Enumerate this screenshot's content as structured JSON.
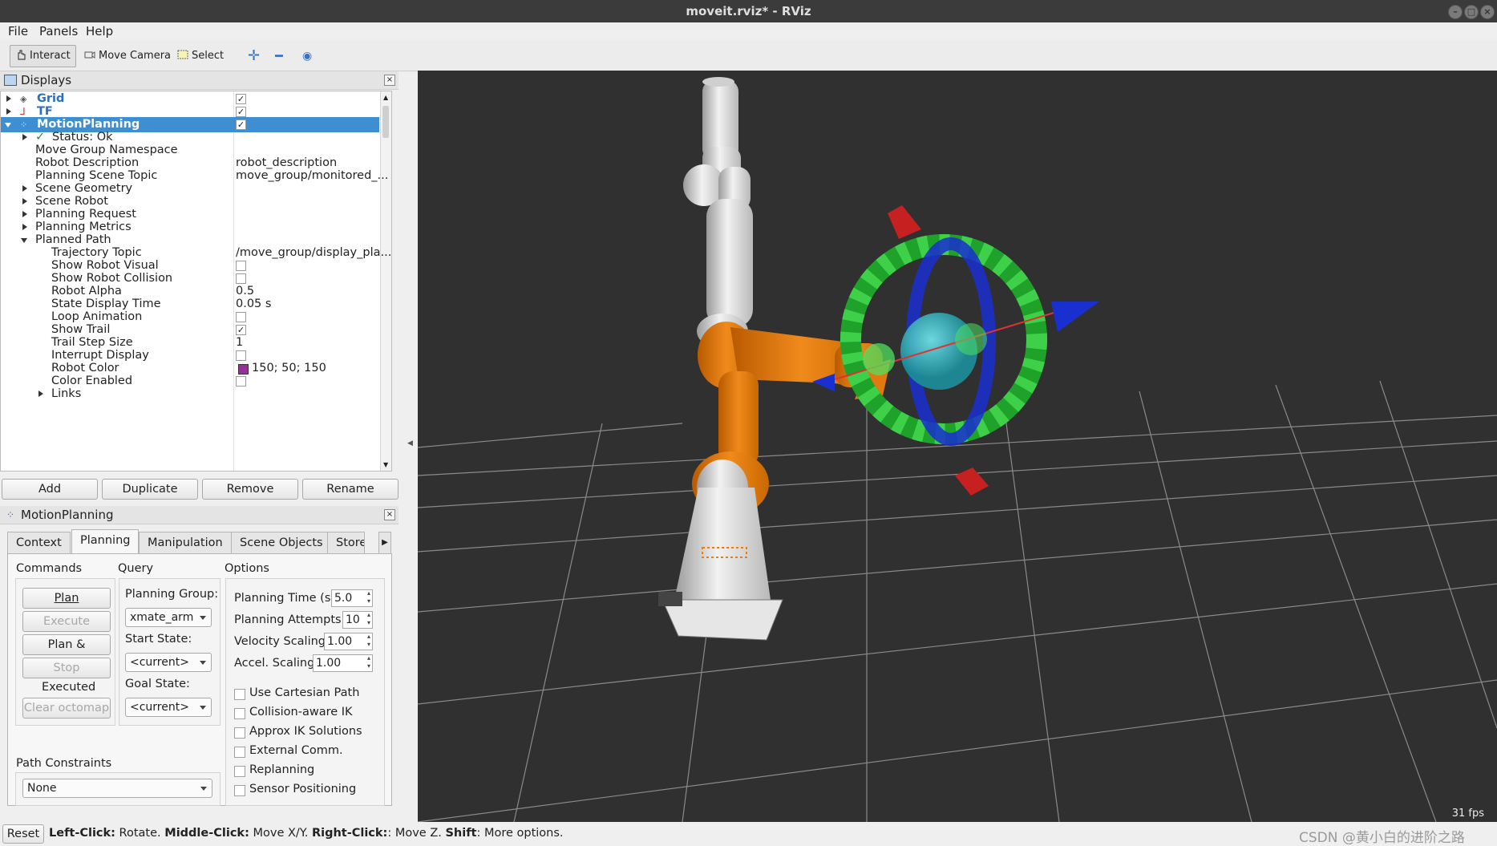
{
  "window": {
    "title": "moveit.rviz* - RViz"
  },
  "menu": [
    "File",
    "Panels",
    "Help"
  ],
  "toolbar": {
    "interact": "Interact",
    "move_camera": "Move Camera",
    "select": "Select"
  },
  "displays": {
    "title": "Displays",
    "rows": [
      {
        "label": "Grid",
        "checked": true
      },
      {
        "label": "TF",
        "checked": true
      },
      {
        "label": "MotionPlanning",
        "checked": true
      },
      {
        "label": "Status: Ok"
      },
      {
        "label": "Move Group Namespace",
        "value": ""
      },
      {
        "label": "Robot Description",
        "value": "robot_description"
      },
      {
        "label": "Planning Scene Topic",
        "value": "move_group/monitored_..."
      },
      {
        "label": "Scene Geometry"
      },
      {
        "label": "Scene Robot"
      },
      {
        "label": "Planning Request"
      },
      {
        "label": "Planning Metrics"
      },
      {
        "label": "Planned Path"
      },
      {
        "label": "Trajectory Topic",
        "value": "/move_group/display_pla..."
      },
      {
        "label": "Show Robot Visual",
        "checked": false
      },
      {
        "label": "Show Robot Collision",
        "checked": false
      },
      {
        "label": "Robot Alpha",
        "value": "0.5"
      },
      {
        "label": "State Display Time",
        "value": "0.05 s"
      },
      {
        "label": "Loop Animation",
        "checked": false
      },
      {
        "label": "Show Trail",
        "checked": true
      },
      {
        "label": "Trail Step Size",
        "value": "1"
      },
      {
        "label": "Interrupt Display",
        "checked": false
      },
      {
        "label": "Robot Color",
        "value": "150; 50; 150",
        "swatch": "#963296"
      },
      {
        "label": "Color Enabled",
        "checked": false
      },
      {
        "label": "Links"
      }
    ],
    "buttons": [
      "Add",
      "Duplicate",
      "Remove",
      "Rename"
    ]
  },
  "motion_panel": {
    "title": "MotionPlanning",
    "tabs": [
      "Context",
      "Planning",
      "Manipulation",
      "Scene Objects",
      "Store"
    ],
    "commands": {
      "header": "Commands",
      "plan": "Plan",
      "execute": "Execute",
      "plan_execute": "Plan & Execute",
      "stop": "Stop",
      "executed": "Executed",
      "clear_octomap": "Clear octomap"
    },
    "query": {
      "header": "Query",
      "planning_group_label": "Planning Group:",
      "planning_group": "xmate_arm",
      "start_state_label": "Start State:",
      "start_state": "<current>",
      "goal_state_label": "Goal State:",
      "goal_state": "<current>"
    },
    "options": {
      "header": "Options",
      "planning_time_label": "Planning Time (s):",
      "planning_time": "5.0",
      "planning_attempts_label": "Planning Attempts:",
      "planning_attempts": "10",
      "velocity_scaling_label": "Velocity Scaling:",
      "velocity_scaling": "1.00",
      "accel_scaling_label": "Accel. Scaling:",
      "accel_scaling": "1.00",
      "checks": [
        "Use Cartesian Path",
        "Collision-aware IK",
        "Approx IK Solutions",
        "External Comm.",
        "Replanning",
        "Sensor Positioning"
      ]
    },
    "path_constraints": {
      "label": "Path Constraints",
      "value": "None"
    }
  },
  "status": {
    "reset": "Reset",
    "k1": "Left-Click:",
    "t1": " Rotate. ",
    "k2": "Middle-Click:",
    "t2": " Move X/Y. ",
    "k3": "Right-Click:",
    "t3": ": Move Z. ",
    "k4": "Shift",
    "t4": ": More options.",
    "fps": "31 fps",
    "watermark": "CSDN @黄小白的进阶之路"
  },
  "colors": {
    "selection": "#3d8fd1",
    "robot_orange": "#e87d12",
    "viewport_bg": "#303030"
  }
}
